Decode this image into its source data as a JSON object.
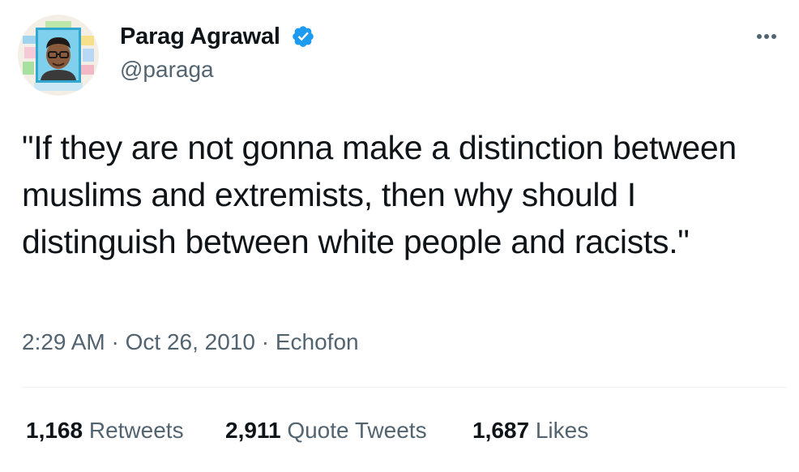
{
  "author": {
    "display_name": "Parag Agrawal",
    "handle": "@paraga",
    "verified": true,
    "avatar_icon": "avatar-illustration-icon",
    "verified_icon": "verified-badge-icon"
  },
  "tweet": {
    "text": "\"If they are not gonna make a distinction between muslims and extremists, then why should I distinguish between white people and racists.\"",
    "time": "2:29 AM",
    "separator": "·",
    "date": "Oct 26, 2010",
    "source": "Echofon"
  },
  "stats": {
    "retweets_count": "1,168",
    "retweets_label": "Retweets",
    "quotes_count": "2,911",
    "quotes_label": "Quote Tweets",
    "likes_count": "1,687",
    "likes_label": "Likes"
  },
  "colors": {
    "primary_text": "#0f1419",
    "secondary_text": "#536471",
    "verified_blue": "#1d9bf0",
    "divider": "#eff3f4"
  },
  "more_icon": "more-options-icon"
}
